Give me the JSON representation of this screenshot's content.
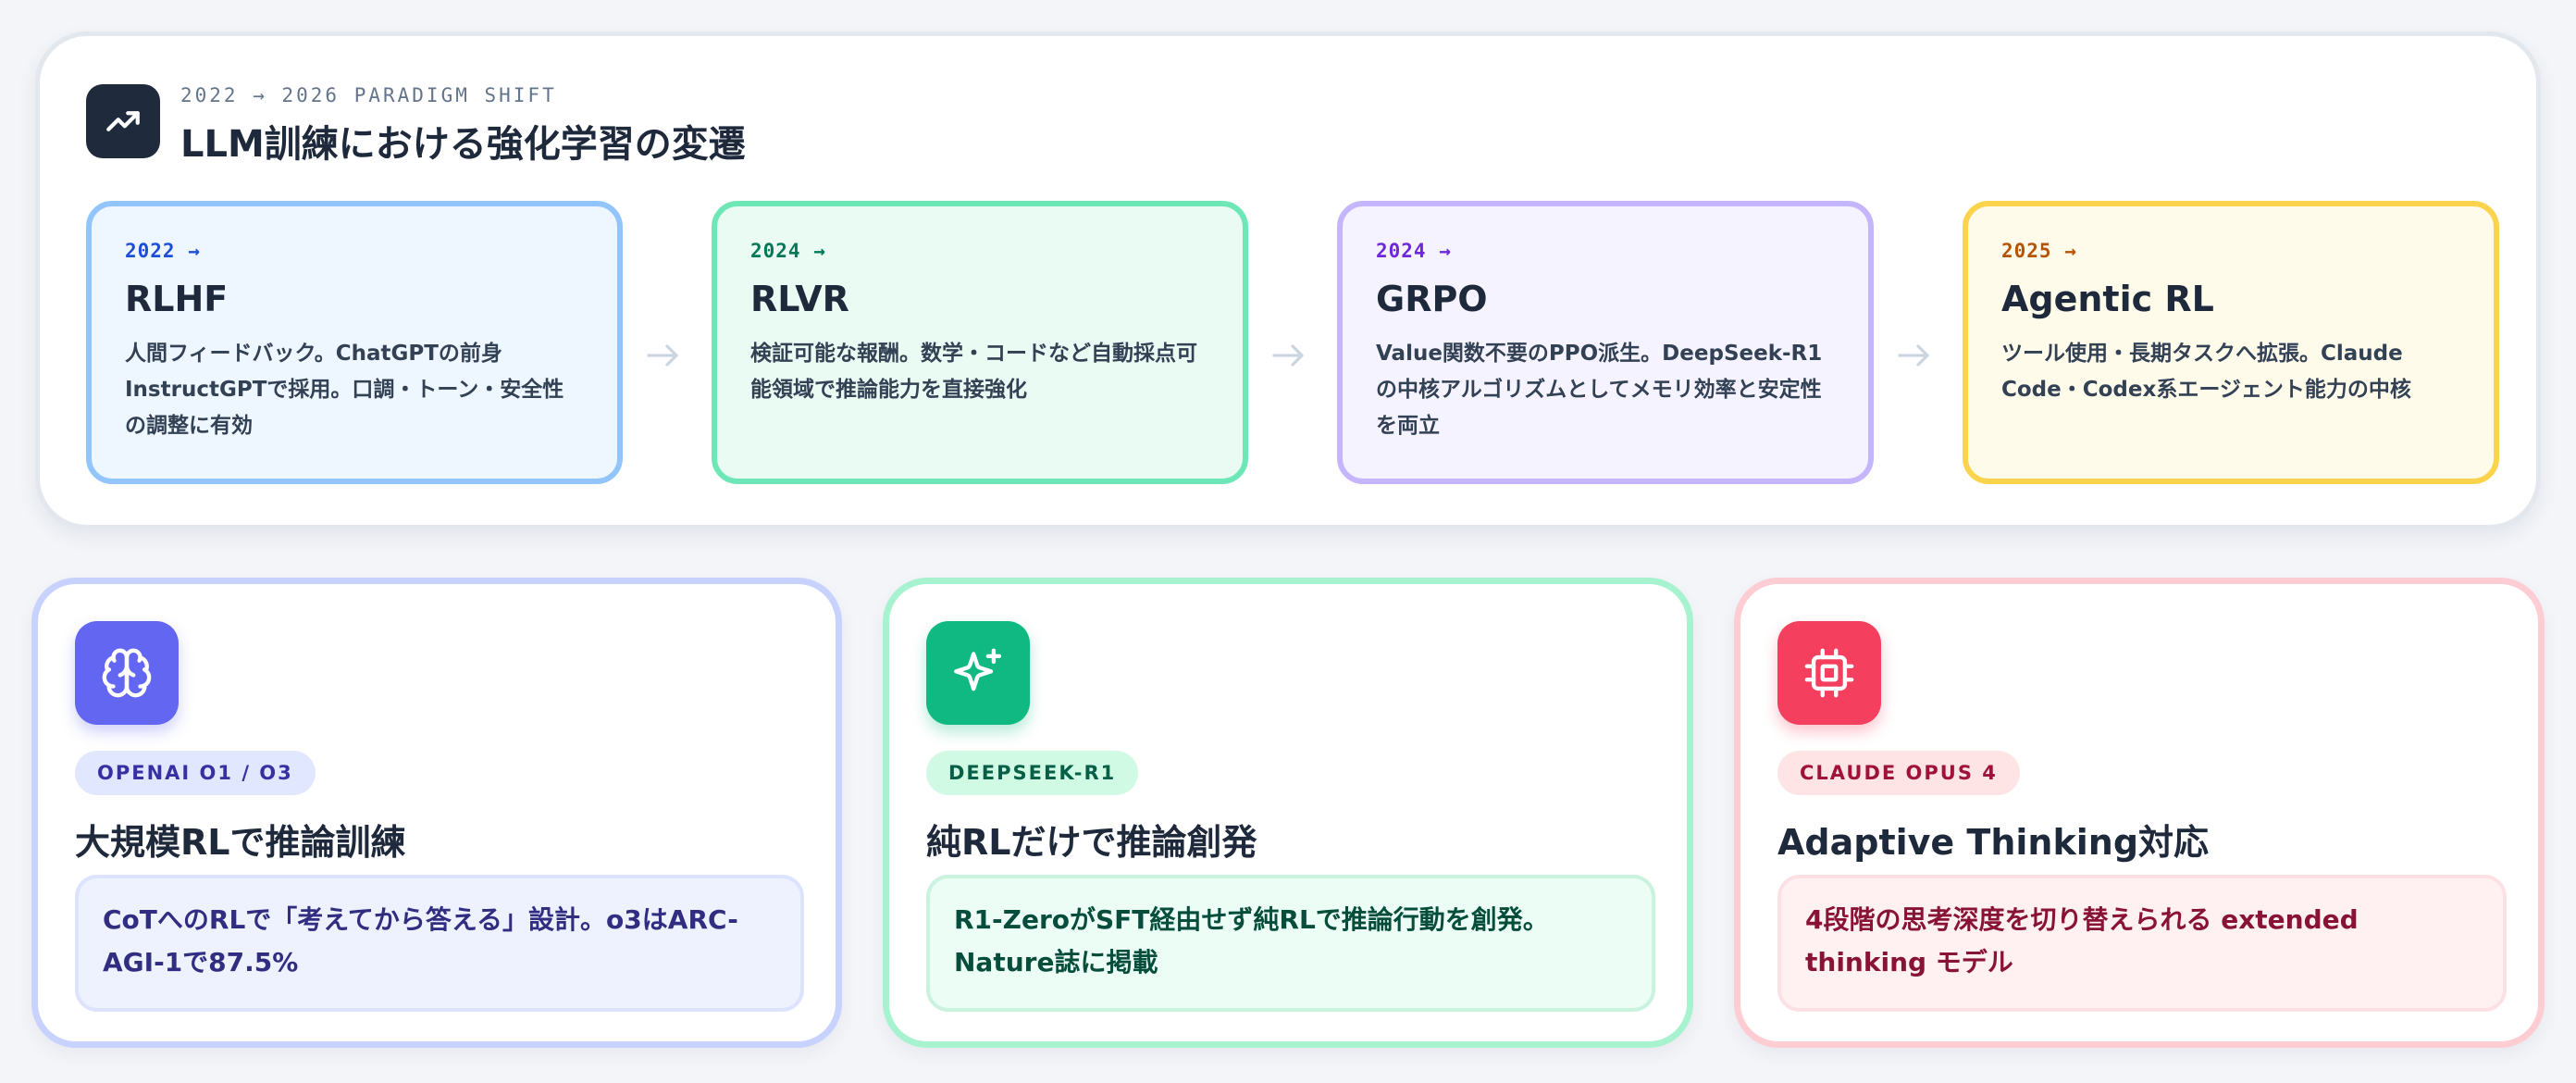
{
  "header": {
    "icon": "trending-up-icon",
    "kicker": "2022 → 2026 PARADIGM SHIFT",
    "title": "LLM訓練における強化学習の変遷"
  },
  "stages": [
    {
      "year": "2022 →",
      "name": "RLHF",
      "description": "人間フィードバック。ChatGPTの前身InstructGPTで採用。口調・トーン・安全性の調整に有効",
      "accent": "#93c5fd",
      "background": "#eef6ff",
      "year_color": "#1d4ed8"
    },
    {
      "year": "2024 →",
      "name": "RLVR",
      "description": "検証可能な報酬。数学・コードなど自動採点可能領域で推論能力を直接強化",
      "accent": "#6ee7b7",
      "background": "#eafbf3",
      "year_color": "#047857"
    },
    {
      "year": "2024 →",
      "name": "GRPO",
      "description": "Value関数不要のPPO派生。DeepSeek-R1の中核アルゴリズムとしてメモリ効率と安定性を両立",
      "accent": "#c4b5fd",
      "background": "#f5f3ff",
      "year_color": "#6d28d9"
    },
    {
      "year": "2025 →",
      "name": "Agentic RL",
      "description": "ツール使用・長期タスクへ拡張。Claude Code・Codex系エージェント能力の中核",
      "accent": "#fcd34d",
      "background": "#fffbeb",
      "year_color": "#b45309"
    }
  ],
  "arrow_icon": "arrow-right-icon",
  "cards": [
    {
      "icon": "brain-icon",
      "badge": "OPENAI O1 / O3",
      "title": "大規模RLで推論訓練",
      "body": "CoTへのRLで「考えてから答える」設計。o3はARC-AGI-1で87.5%",
      "accent": "#6366f1",
      "border": "#c7d2fe",
      "badge_bg": "#e0e7ff",
      "badge_color": "#3730a3",
      "box_bg": "#eef2ff",
      "box_border": "#dbe3ff",
      "text_color": "#312e81"
    },
    {
      "icon": "sparkles-icon",
      "badge": "DEEPSEEK-R1",
      "title": "純RLだけで推論創発",
      "body": "R1-ZeroがSFT経由せず純RLで推論行動を創発。Nature誌に掲載",
      "accent": "#10b981",
      "border": "#a7f3d0",
      "badge_bg": "#d1fae5",
      "badge_color": "#065f46",
      "box_bg": "#ecfdf5",
      "box_border": "#c9f3df",
      "text_color": "#064e3b"
    },
    {
      "icon": "cpu-icon",
      "badge": "CLAUDE OPUS 4",
      "title": "Adaptive Thinking対応",
      "body": "4段階の思考深度を切り替えられる extended thinking モデル",
      "accent": "#f43f5e",
      "border": "#fecdd3",
      "badge_bg": "#ffe4e6",
      "badge_color": "#9f1239",
      "box_bg": "#fff1f2",
      "box_border": "#fde0e4",
      "text_color": "#881337"
    }
  ]
}
